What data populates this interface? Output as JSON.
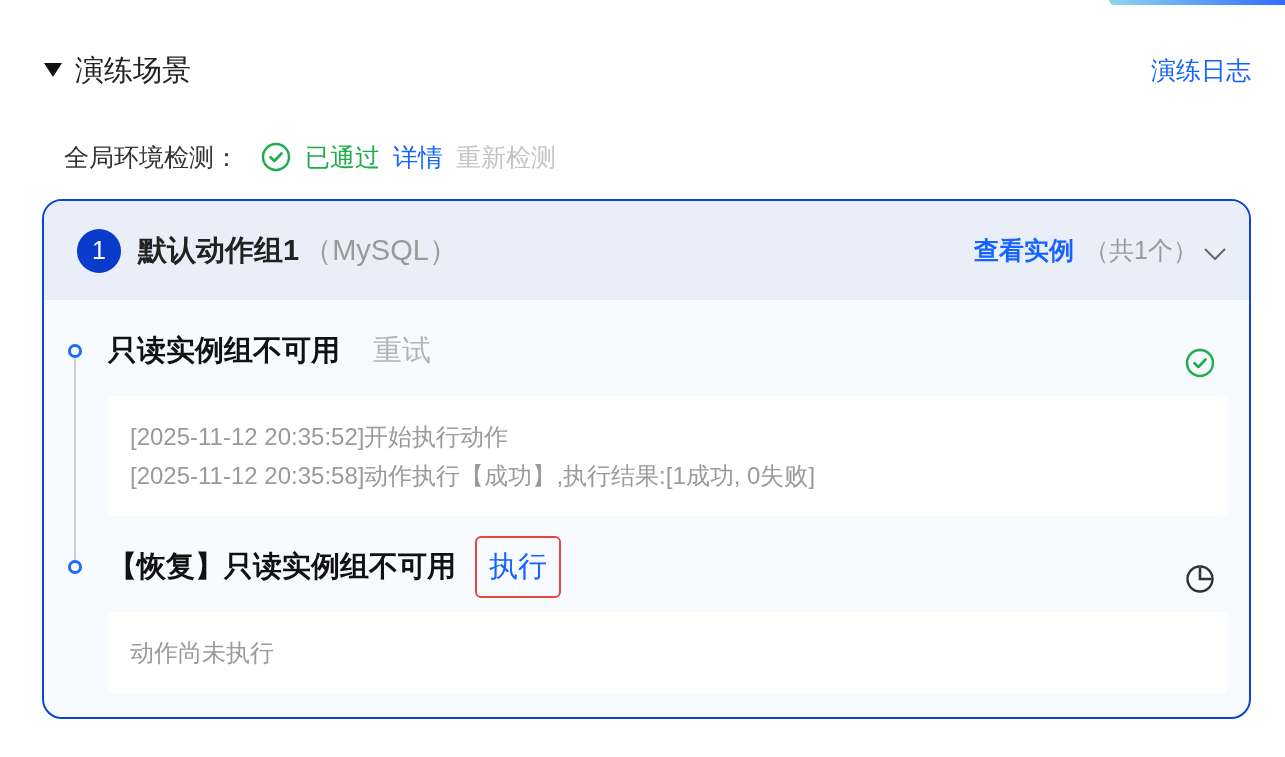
{
  "section": {
    "title": "演练场景",
    "expanded": true,
    "log_link": "演练日志"
  },
  "environment_check": {
    "label": "全局环境检测：",
    "passed": true,
    "status_text": "已通过",
    "details_link": "详情",
    "recheck": {
      "label": "重新检测",
      "disabled": true
    }
  },
  "action_group": {
    "index": "1",
    "name": "默认动作组1",
    "type": "（MySQL）",
    "instances_link": "查看实例",
    "instance_count": "（共1个）",
    "steps": [
      {
        "title": "只读实例组不可用",
        "action": {
          "label": "重试",
          "disabled": true,
          "highlighted": false
        },
        "completed": true,
        "log": [
          "[2025-11-12 20:35:52]开始执行动作",
          "[2025-11-12 20:35:58]动作执行【成功】,执行结果:[1成功, 0失败]"
        ]
      },
      {
        "title": "【恢复】只读实例组不可用",
        "action": {
          "label": "执行",
          "disabled": false,
          "highlighted": true
        },
        "completed": false,
        "log": [
          "动作尚未执行"
        ]
      }
    ]
  }
}
